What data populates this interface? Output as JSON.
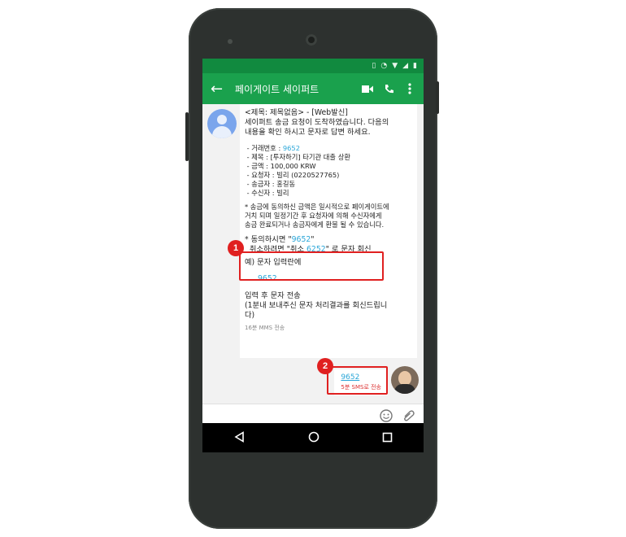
{
  "app": {
    "title": "페이게이트 세이퍼트",
    "back_icon": "arrow-left-icon",
    "actions": [
      "video-call-icon",
      "phone-icon",
      "more-vert-icon"
    ]
  },
  "status": {
    "icons": [
      "vibrate-icon",
      "alarm-icon",
      "wifi-icon",
      "signal-icon",
      "battery-icon"
    ]
  },
  "message": {
    "line1": "<제목: 제목없음> - [Web발신]",
    "line2": "세이퍼트 송금 요청이 도착하였습니다. 다음의",
    "line3": "내용을 확인 하시고 문자로 답변 하세요.",
    "details": [
      {
        "label": " - 거래번호 : ",
        "value": "9652"
      },
      {
        "label": " - 제목 : [투자하기] 타기관 대출 상환",
        "value": ""
      },
      {
        "label": " - 금액 : 100,000 KRW",
        "value": ""
      },
      {
        "label": " - 요청자 : 빌리 (0220527765)",
        "value": ""
      },
      {
        "label": " - 송금자 : 홍길동",
        "value": ""
      },
      {
        "label": " - 수신자 : 빌리",
        "value": ""
      }
    ],
    "notice1": "* 송금에 동의하신 금액은 일시적으로 페이게이트에",
    "notice2": "거치 되며 일정기간 후 요청자에 의해 수신자에게",
    "notice3": "송금 완료되거나 송금자에게 환불 될 수 있습니다.",
    "agree_prefix": "* 동의하시면 \"",
    "agree_code": "9652",
    "agree_suffix": "\"",
    "cancel_prefix": "  취소하려면 \"취소 ",
    "cancel_code": "6252",
    "cancel_suffix": "\" 로 문자 회신",
    "example": "예) 문자 입력란에",
    "example_code": "9652",
    "after1": "입력 후 문자 전송",
    "after2": "(1분내 보내주신 문자 처리결과를 회신드립니",
    "after3": "다)",
    "meta": "16분 MMS 전송"
  },
  "reply": {
    "text": "9652",
    "meta": "5분 SMS로 전송"
  },
  "annotations": {
    "badge1": "1",
    "badge2": "2"
  },
  "compose": {
    "icons": [
      "emoji-icon",
      "attach-icon"
    ]
  },
  "nav": {
    "icons": [
      "back-triangle-icon",
      "home-circle-icon",
      "recents-square-icon"
    ]
  },
  "colors": {
    "appbar": "#1aa14d",
    "statusbar": "#118a3f",
    "link": "#2aa6d8",
    "highlight": "#e02020"
  }
}
